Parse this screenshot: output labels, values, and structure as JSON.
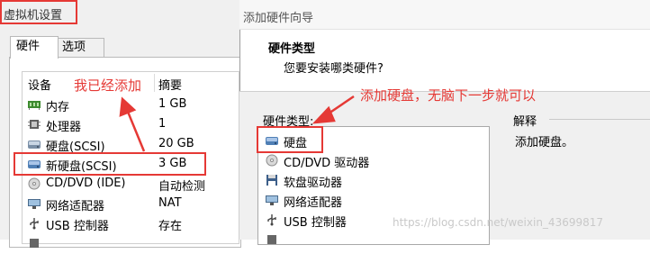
{
  "left_window": {
    "title": "虚拟机设置",
    "tabs": [
      "硬件",
      "选项"
    ],
    "columns": {
      "device": "设备",
      "summary": "摘要"
    },
    "devices": [
      {
        "name": "内存",
        "summary": "1 GB",
        "icon": "memory-icon"
      },
      {
        "name": "处理器",
        "summary": "1",
        "icon": "processor-icon"
      },
      {
        "name": "硬盘(SCSI)",
        "summary": "20 GB",
        "icon": "hard-disk-icon"
      },
      {
        "name": "新硬盘(SCSI)",
        "summary": "3 GB",
        "icon": "hard-disk-icon"
      },
      {
        "name": "CD/DVD (IDE)",
        "summary": "自动检测",
        "icon": "cd-dvd-icon"
      },
      {
        "name": "网络适配器",
        "summary": "NAT",
        "icon": "network-icon"
      },
      {
        "name": "USB 控制器",
        "summary": "存在",
        "icon": "usb-icon"
      }
    ],
    "annotation": "我已经添加"
  },
  "wizard": {
    "title": "添加硬件向导",
    "heading": "硬件类型",
    "question": "您要安装哪类硬件?",
    "hardware_type_label": "硬件类型:",
    "hardware_types": [
      {
        "name": "硬盘",
        "icon": "hard-disk-icon"
      },
      {
        "name": "CD/DVD 驱动器",
        "icon": "cd-dvd-icon"
      },
      {
        "name": "软盘驱动器",
        "icon": "floppy-icon"
      },
      {
        "name": "网络适配器",
        "icon": "network-icon"
      },
      {
        "name": "USB 控制器",
        "icon": "usb-icon"
      }
    ],
    "explain_label": "解释",
    "explain_text": "添加硬盘。",
    "annotation": "添加硬盘，无脑下一步就可以"
  },
  "watermark": "https://blog.csdn.net/weixin_43699817",
  "colors": {
    "annotation": "#e53935"
  }
}
